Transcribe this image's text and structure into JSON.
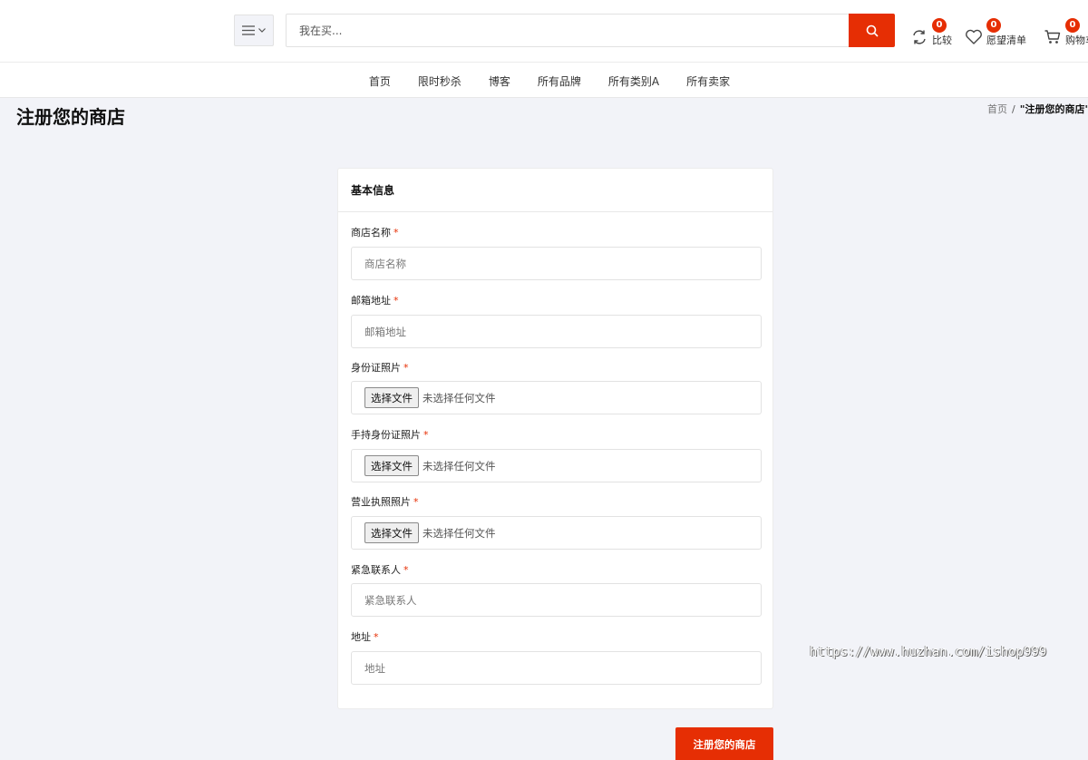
{
  "header": {
    "search_placeholder": "我在买...",
    "compare": {
      "label": "比较",
      "count": "0"
    },
    "wishlist": {
      "label": "愿望清单",
      "count": "0"
    },
    "cart": {
      "label": "购物车",
      "count": "0"
    }
  },
  "nav": [
    "首页",
    "限时秒杀",
    "博客",
    "所有品牌",
    "所有类别A",
    "所有卖家"
  ],
  "page": {
    "title": "注册您的商店",
    "breadcrumb": {
      "home": "首页",
      "separator": "/",
      "current": "\"注册您的商店\""
    }
  },
  "form": {
    "section_title": "基本信息",
    "required_mark": "*",
    "shop_name": {
      "label": "商店名称",
      "placeholder": "商店名称"
    },
    "email": {
      "label": "邮箱地址",
      "placeholder": "邮箱地址"
    },
    "id_photo": {
      "label": "身份证照片",
      "button": "选择文件",
      "status": "未选择任何文件"
    },
    "hand_id_photo": {
      "label": "手持身份证照片",
      "button": "选择文件",
      "status": "未选择任何文件"
    },
    "license_photo": {
      "label": "营业执照照片",
      "button": "选择文件",
      "status": "未选择任何文件"
    },
    "emergency_contact": {
      "label": "紧急联系人",
      "placeholder": "紧急联系人"
    },
    "address": {
      "label": "地址",
      "placeholder": "地址"
    },
    "submit_label": "注册您的商店"
  },
  "watermark": "https://www.huzhan.com/ishop999",
  "colors": {
    "accent": "#e62e04",
    "background": "#f2f3f8"
  }
}
